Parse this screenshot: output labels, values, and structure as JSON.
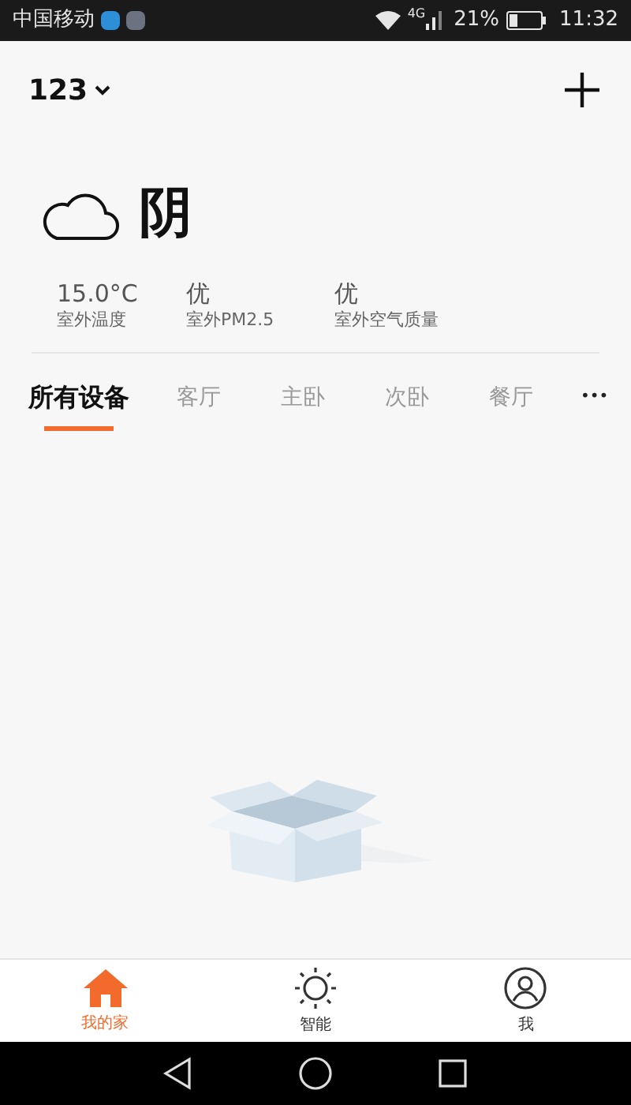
{
  "status_bar": {
    "carrier": "中国移动",
    "network": "4G",
    "battery": "21%",
    "time": "11:32"
  },
  "header": {
    "home_name": "123"
  },
  "weather": {
    "condition": "阴",
    "stats": [
      {
        "value": "15.0°C",
        "label": "室外温度"
      },
      {
        "value": "优",
        "label": "室外PM2.5"
      },
      {
        "value": "优",
        "label": "室外空气质量"
      }
    ]
  },
  "tabs": [
    {
      "label": "所有设备",
      "selected": true
    },
    {
      "label": "客厅",
      "selected": false
    },
    {
      "label": "主卧",
      "selected": false
    },
    {
      "label": "次卧",
      "selected": false
    },
    {
      "label": "餐厅",
      "selected": false
    }
  ],
  "more_tabs": "•••",
  "bottom_nav": [
    {
      "label": "我的家",
      "kind": "home",
      "selected": true
    },
    {
      "label": "智能",
      "kind": "smart",
      "selected": false
    },
    {
      "label": "我",
      "kind": "me",
      "selected": false
    }
  ]
}
